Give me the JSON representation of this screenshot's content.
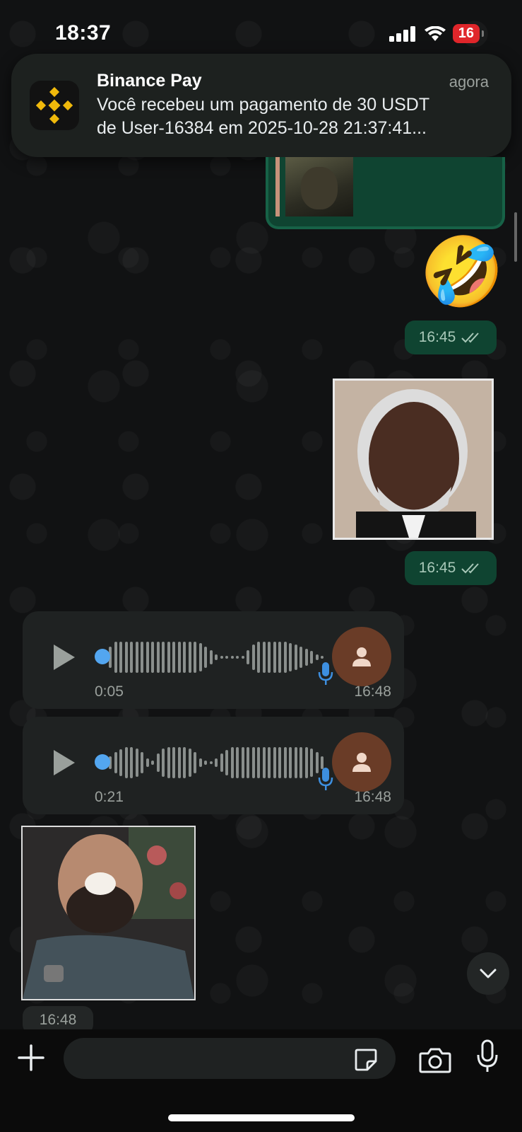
{
  "status": {
    "time": "18:37",
    "battery": "16"
  },
  "notification": {
    "app": "Binance Pay",
    "time": "agora",
    "line1": "Você recebeu um pagamento de 30 USDT",
    "line2": "de User-16384 em 2025-10-28 21:37:41..."
  },
  "messages": {
    "emoji": "🤣",
    "emoji_time": "16:45",
    "photo_time": "16:45",
    "voice1": {
      "duration": "0:05",
      "time": "16:48"
    },
    "voice2": {
      "duration": "0:21",
      "time": "16:48"
    },
    "gif_time": "16:48"
  },
  "colors": {
    "sent_bubble": "#0f4431",
    "received_bubble": "#1f2222",
    "accent_blue": "#53a6f0",
    "battery_red": "#e0262b"
  },
  "icons": {
    "read_receipt": "double-check-icon",
    "play": "play-icon",
    "mic": "mic-icon",
    "scroll_down": "chevron-down-icon",
    "attach": "plus-icon",
    "sticker": "sticker-icon",
    "camera": "camera-icon"
  }
}
